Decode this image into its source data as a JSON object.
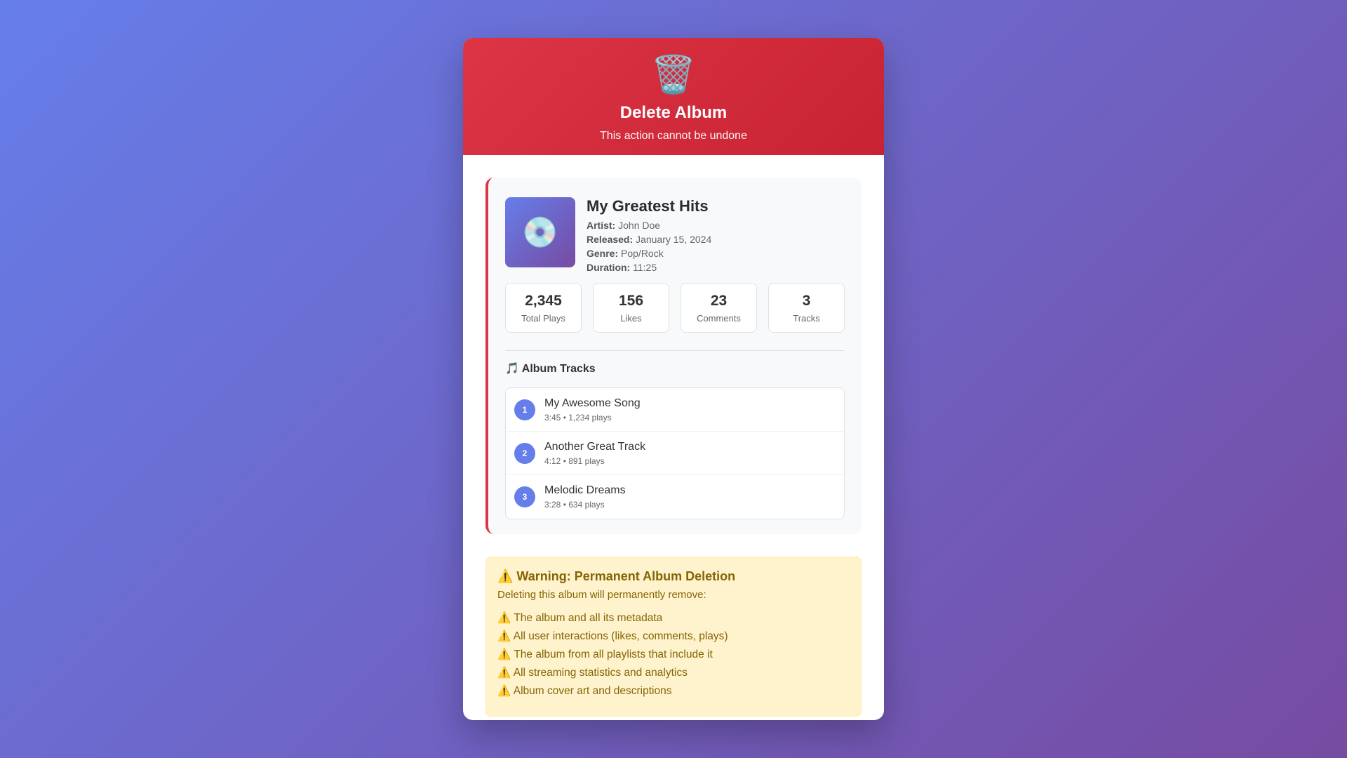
{
  "header": {
    "icon": "🗑️",
    "title": "Delete Album",
    "subtitle": "This action cannot be undone"
  },
  "album": {
    "cover_icon": "💿",
    "title": "My Greatest Hits",
    "meta": [
      {
        "label": "Artist:",
        "value": "John Doe"
      },
      {
        "label": "Released:",
        "value": "January 15, 2024"
      },
      {
        "label": "Genre:",
        "value": "Pop/Rock"
      },
      {
        "label": "Duration:",
        "value": "11:25"
      }
    ],
    "stats": [
      {
        "value": "2,345",
        "label": "Total Plays"
      },
      {
        "value": "156",
        "label": "Likes"
      },
      {
        "value": "23",
        "label": "Comments"
      },
      {
        "value": "3",
        "label": "Tracks"
      }
    ],
    "tracks_heading": "🎵 Album Tracks",
    "tracks": [
      {
        "num": "1",
        "name": "My Awesome Song",
        "meta": "3:45 • 1,234 plays"
      },
      {
        "num": "2",
        "name": "Another Great Track",
        "meta": "4:12 • 891 plays"
      },
      {
        "num": "3",
        "name": "Melodic Dreams",
        "meta": "3:28 • 634 plays"
      }
    ]
  },
  "warning": {
    "title": "⚠️ Warning: Permanent Album Deletion",
    "intro": "Deleting this album will permanently remove:",
    "items": [
      "⚠️ The album and all its metadata",
      "⚠️ All user interactions (likes, comments, plays)",
      "⚠️ The album from all playlists that include it",
      "⚠️ All streaming statistics and analytics",
      "⚠️ Album cover art and descriptions"
    ]
  },
  "colors": {
    "danger": "#dc3545",
    "accent": "#667eea",
    "warning_text": "#856404",
    "warning_bg": "#fff3cd"
  }
}
